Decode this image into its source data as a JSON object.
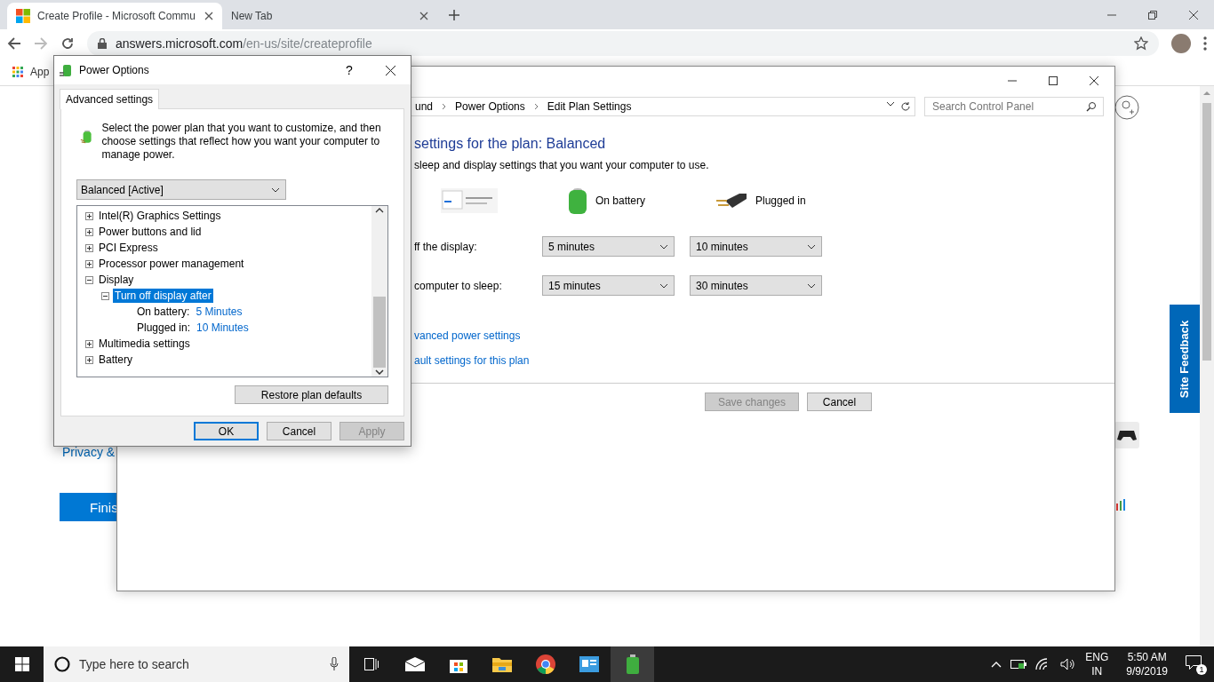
{
  "browser": {
    "tabs": [
      {
        "title": "Create Profile - Microsoft Commu",
        "selected": true
      },
      {
        "title": "New Tab",
        "selected": false
      }
    ],
    "url_host": "answers.microsoft.com",
    "url_path": "/en-us/site/createprofile",
    "bookmarks": [
      "App"
    ]
  },
  "page": {
    "privacy_link": "Privacy &",
    "finish_button": "Finis",
    "feedback_tab": "Site Feedback"
  },
  "control_panel": {
    "breadcrumbs": [
      "und",
      "Power Options",
      "Edit Plan Settings"
    ],
    "search": {
      "placeholder": "Search Control Panel"
    },
    "heading": "settings for the plan: Balanced",
    "subheading": "sleep and display settings that you want your computer to use.",
    "columns": [
      "On battery",
      "Plugged in"
    ],
    "rows": [
      {
        "label": "ff the display:",
        "values": [
          "5 minutes",
          "10 minutes"
        ]
      },
      {
        "label": "computer to sleep:",
        "values": [
          "15 minutes",
          "30 minutes"
        ]
      }
    ],
    "links": [
      "vanced power settings",
      "ault settings for this plan"
    ],
    "buttons": [
      {
        "label": "Save changes",
        "disabled": true
      },
      {
        "label": "Cancel",
        "disabled": false
      }
    ]
  },
  "dialog": {
    "title": "Power Options",
    "help": "?",
    "tabs": [
      {
        "label": "Advanced settings",
        "selected": true
      }
    ],
    "description": "Select the power plan that you want to customize, and then choose settings that reflect how you want your computer to manage power.",
    "plan": "Balanced [Active]",
    "tree": [
      {
        "kind": "group",
        "label": "Intel(R) Graphics Settings",
        "expanded": false,
        "selected": false
      },
      {
        "kind": "group",
        "label": "Power buttons and lid",
        "expanded": false,
        "selected": false
      },
      {
        "kind": "group",
        "label": "PCI Express",
        "expanded": false,
        "selected": false
      },
      {
        "kind": "group",
        "label": "Processor power management",
        "expanded": false,
        "selected": false
      },
      {
        "kind": "group",
        "label": "Display",
        "expanded": true,
        "selected": false,
        "children": [
          {
            "kind": "group",
            "label": "Turn off display after",
            "expanded": true,
            "selected": true,
            "children": [
              {
                "kind": "value",
                "label": "On battery:",
                "value": "5 Minutes"
              },
              {
                "kind": "value",
                "label": "Plugged in:",
                "value": "10 Minutes"
              }
            ]
          }
        ]
      },
      {
        "kind": "group",
        "label": "Multimedia settings",
        "expanded": false,
        "selected": false
      },
      {
        "kind": "group",
        "label": "Battery",
        "expanded": false,
        "selected": false
      }
    ],
    "restore_button": "Restore plan defaults",
    "buttons": [
      {
        "label": "OK",
        "default": true,
        "disabled": false
      },
      {
        "label": "Cancel",
        "default": false,
        "disabled": false
      },
      {
        "label": "Apply",
        "default": false,
        "disabled": true
      }
    ]
  },
  "taskbar": {
    "search": {
      "placeholder": "Type here to search"
    },
    "language": "ENG",
    "region": "IN",
    "time": "5:50 AM",
    "date": "9/9/2019",
    "notifications": "1"
  }
}
